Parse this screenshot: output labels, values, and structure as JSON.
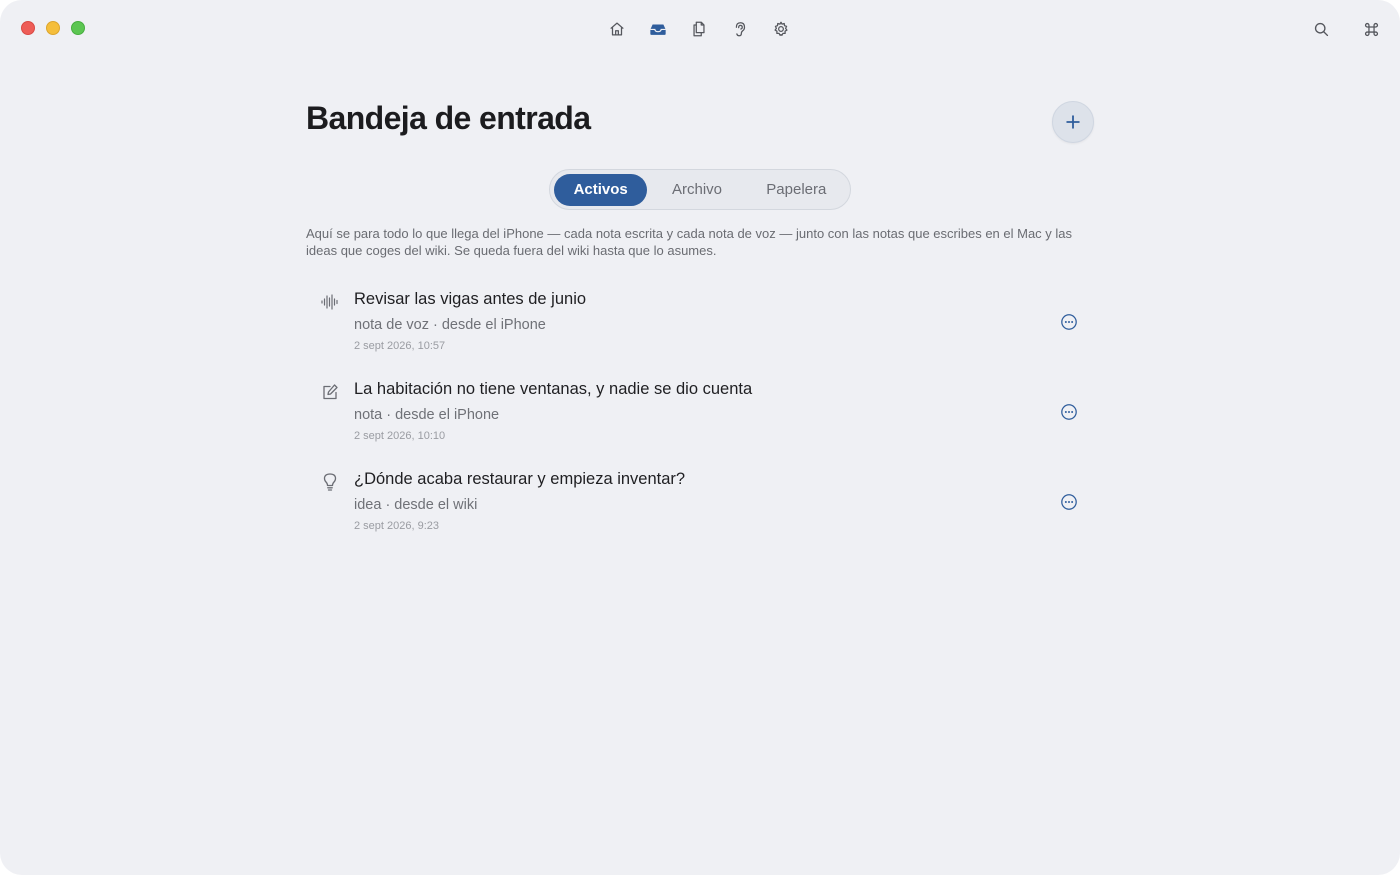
{
  "window": {
    "traffic_lights": [
      "close",
      "minimize",
      "maximize"
    ]
  },
  "topnav": {
    "items": [
      {
        "icon": "home-icon",
        "label": "Inicio",
        "active": false
      },
      {
        "icon": "inbox-icon",
        "label": "Bandeja de entrada",
        "active": true
      },
      {
        "icon": "documents-icon",
        "label": "Documentos",
        "active": false
      },
      {
        "icon": "ear-icon",
        "label": "Escuchar",
        "active": false
      },
      {
        "icon": "gear-icon",
        "label": "Ajustes",
        "active": false
      }
    ],
    "right": [
      {
        "icon": "search-icon"
      },
      {
        "icon": "command-icon"
      }
    ]
  },
  "page": {
    "title": "Bandeja de entrada",
    "description": "Aquí se para todo lo que llega del iPhone — cada nota escrita y cada nota de voz — junto con las notas que escribes en el Mac y las ideas que coges del wiki. Se queda fuera del wiki hasta que lo asumes."
  },
  "tabs": [
    {
      "label": "Activos",
      "selected": true
    },
    {
      "label": "Archivo",
      "selected": false
    },
    {
      "label": "Papelera",
      "selected": false
    }
  ],
  "items": [
    {
      "icon": "waveform-icon",
      "title": "Revisar las vigas antes de junio",
      "meta": "nota de voz · desde el iPhone",
      "timestamp": "2 sept 2026, 10:57"
    },
    {
      "icon": "compose-note-icon",
      "title": "La habitación no tiene ventanas, y nadie se dio cuenta",
      "meta": "nota · desde el iPhone",
      "timestamp": "2 sept 2026, 10:10"
    },
    {
      "icon": "lightbulb-icon",
      "title": "¿Dónde acaba restaurar y empieza inventar?",
      "meta": "idea · desde el wiki",
      "timestamp": "2 sept 2026, 9:23"
    }
  ],
  "colors": {
    "accent": "#2f5d9c",
    "background": "#eff0f4",
    "icon_gray": "#6b6d74"
  }
}
